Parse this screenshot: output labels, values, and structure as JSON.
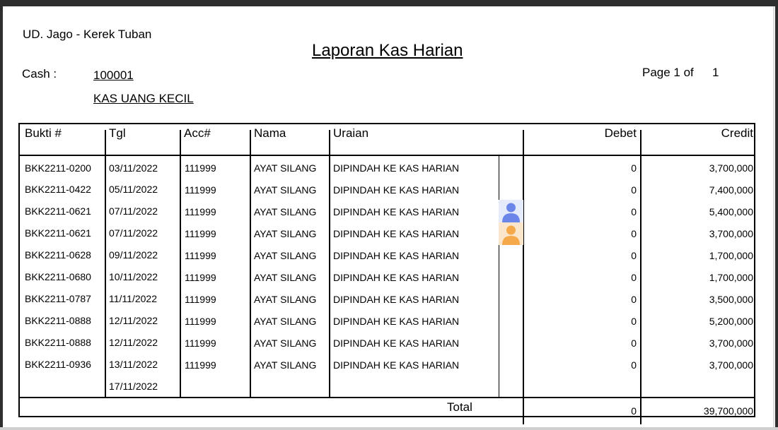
{
  "report": {
    "company": "UD. Jago - Kerek Tuban",
    "title": "Laporan Kas Harian",
    "cash_label": "Cash :",
    "cash_code": "100001",
    "cash_name": "KAS UANG KECIL",
    "page_label": "Page 1 of",
    "page_total": "1"
  },
  "table": {
    "headers": {
      "bukti": "Bukti #",
      "tgl": "Tgl",
      "acc": "Acc#",
      "nama": "Nama",
      "uraian": "Uraian",
      "debet": "Debet",
      "credit": "Credit"
    },
    "rows": [
      {
        "bukti": "BKK2211-0200",
        "tgl": "03/11/2022",
        "acc": "111999",
        "nama": "AYAT SILANG",
        "uraian": "DIPINDAH KE KAS HARIAN",
        "debet": "0",
        "credit": "3,700,000"
      },
      {
        "bukti": "BKK2211-0422",
        "tgl": "05/11/2022",
        "acc": "111999",
        "nama": "AYAT SILANG",
        "uraian": "DIPINDAH KE KAS HARIAN",
        "debet": "0",
        "credit": "7,400,000"
      },
      {
        "bukti": "BKK2211-0621",
        "tgl": "07/11/2022",
        "acc": "111999",
        "nama": "AYAT SILANG",
        "uraian": "DIPINDAH KE KAS HARIAN",
        "debet": "0",
        "credit": "5,400,000"
      },
      {
        "bukti": "BKK2211-0621",
        "tgl": "07/11/2022",
        "acc": "111999",
        "nama": "AYAT SILANG",
        "uraian": "DIPINDAH KE KAS HARIAN",
        "debet": "0",
        "credit": "3,700,000"
      },
      {
        "bukti": "BKK2211-0628",
        "tgl": "09/11/2022",
        "acc": "111999",
        "nama": "AYAT SILANG",
        "uraian": "DIPINDAH KE KAS HARIAN",
        "debet": "0",
        "credit": "1,700,000"
      },
      {
        "bukti": "BKK2211-0680",
        "tgl": "10/11/2022",
        "acc": "111999",
        "nama": "AYAT SILANG",
        "uraian": "DIPINDAH KE KAS HARIAN",
        "debet": "0",
        "credit": "1,700,000"
      },
      {
        "bukti": "BKK2211-0787",
        "tgl": "11/11/2022",
        "acc": "111999",
        "nama": "AYAT SILANG",
        "uraian": "DIPINDAH KE KAS HARIAN",
        "debet": "0",
        "credit": "3,500,000"
      },
      {
        "bukti": "BKK2211-0888",
        "tgl": "12/11/2022",
        "acc": "111999",
        "nama": "AYAT SILANG",
        "uraian": "DIPINDAH KE KAS HARIAN",
        "debet": "0",
        "credit": "5,200,000"
      },
      {
        "bukti": "BKK2211-0888",
        "tgl": "12/11/2022",
        "acc": "111999",
        "nama": "AYAT SILANG",
        "uraian": "DIPINDAH KE KAS HARIAN",
        "debet": "0",
        "credit": "3,700,000"
      },
      {
        "bukti": "BKK2211-0936",
        "tgl": "13/11/2022",
        "acc": "111999",
        "nama": "AYAT SILANG",
        "uraian": "DIPINDAH KE KAS HARIAN",
        "debet": "0",
        "credit": "3,700,000"
      },
      {
        "bukti": "",
        "tgl": "17/11/2022",
        "acc": "",
        "nama": "",
        "uraian": "",
        "debet": "",
        "credit": ""
      }
    ],
    "total_label": "Total",
    "total_debet": "0",
    "total_credit": "39,700,000"
  },
  "icons": {
    "avatar_1": {
      "name": "user-avatar-icon",
      "color": "#6b86e8"
    },
    "avatar_2": {
      "name": "user-avatar-icon",
      "color": "#f5a94a"
    }
  }
}
